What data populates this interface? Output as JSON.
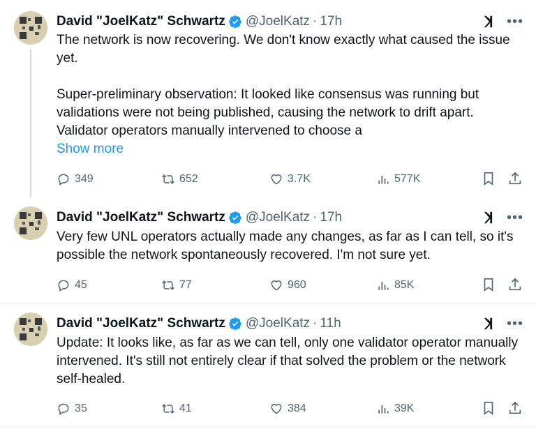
{
  "tweets": [
    {
      "name": "David \"JoelKatz\" Schwartz",
      "handle": "@JoelKatz",
      "time": "17h",
      "paragraphs": [
        "The network is now recovering. We don't know exactly what caused the issue yet.",
        "Super-preliminary observation: It looked like consensus was running but validations were not being published, causing the network to drift apart. Validator operators manually intervened to choose a"
      ],
      "show_more": "Show more",
      "replies": "349",
      "reposts": "652",
      "likes": "3.7K",
      "views": "577K"
    },
    {
      "name": "David \"JoelKatz\" Schwartz",
      "handle": "@JoelKatz",
      "time": "17h",
      "paragraphs": [
        "Very few UNL operators actually made any changes, as far as I can tell, so it's possible the network spontaneously recovered. I'm not sure yet."
      ],
      "replies": "45",
      "reposts": "77",
      "likes": "960",
      "views": "85K"
    },
    {
      "name": "David \"JoelKatz\" Schwartz",
      "handle": "@JoelKatz",
      "time": "11h",
      "paragraphs": [
        "Update: It looks like, as far as we can tell, only one validator operator manually intervened. It's still not entirely clear if that solved the problem or the network self-healed."
      ],
      "replies": "35",
      "reposts": "41",
      "likes": "384",
      "views": "39K"
    }
  ],
  "separator": "·",
  "more_glyph": "•••",
  "icons": [
    "verified-badge-icon",
    "grok-icon",
    "more-icon",
    "reply-icon",
    "repost-icon",
    "like-icon",
    "views-icon",
    "bookmark-icon",
    "share-icon"
  ],
  "colors": {
    "accent": "#1d9bf0",
    "text": "#0f1419",
    "muted": "#536471",
    "thread_line": "#cfd9de"
  }
}
